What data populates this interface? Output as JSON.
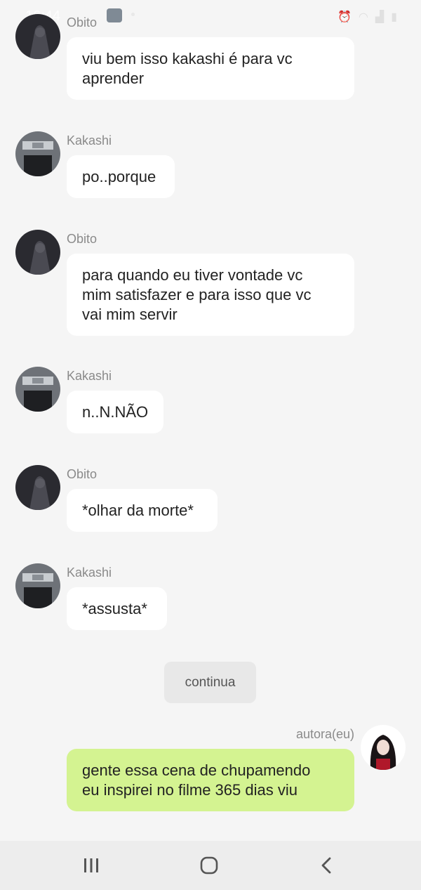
{
  "status_bar": {
    "time": "16:44"
  },
  "messages": [
    {
      "sender": "Obito",
      "text_lines": [
        "viu bem isso kakashi é para vc",
        "aprender"
      ]
    },
    {
      "sender": "Kakashi",
      "text_lines": [
        "po..porque"
      ]
    },
    {
      "sender": "Obito",
      "text_lines": [
        "para quando eu tiver vontade vc",
        "mim satisfazer e para isso que vc",
        "vai mim servir"
      ]
    },
    {
      "sender": "Kakashi",
      "text_lines": [
        "n..N.NÃO"
      ]
    },
    {
      "sender": "Obito",
      "text_lines": [
        "*olhar da morte*"
      ]
    },
    {
      "sender": "Kakashi",
      "text_lines": [
        "*assusta*"
      ]
    },
    {
      "sender": "autora(eu)",
      "text_lines": [
        "gente essa cena de chupamendo",
        "eu inspirei no filme 365 dias viu"
      ]
    }
  ],
  "continue_button": {
    "label": "continua"
  },
  "navigation_bar": {
    "items": [
      "recent-apps-icon",
      "home-icon",
      "back-icon"
    ]
  },
  "colors": {
    "background": "#f5f5f5",
    "bubble": "#ffffff",
    "self_bubble": "#d4f391",
    "sender_name": "#8a8a8a"
  }
}
